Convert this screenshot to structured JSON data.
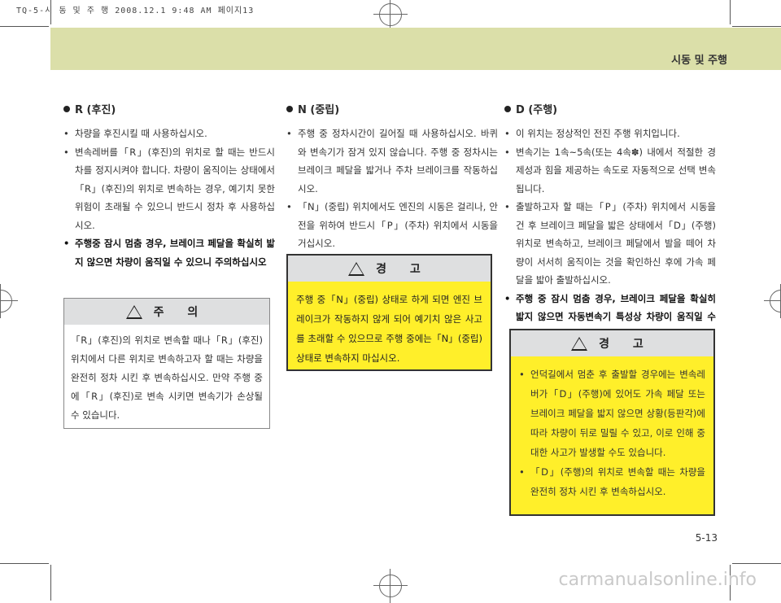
{
  "print_info": "TQ-5-시 동 및 주 행  2008.12.1 9:48 AM 페이지13",
  "header": {
    "title": "시동 및 주행"
  },
  "sections": {
    "r": {
      "title": "R (후진)",
      "items": [
        "차량을 후진시킬 때 사용하십시오.",
        "변속레버를「R」(후진)의 위치로 할 때는 반드시 차를 정지시켜야 합니다. 차량이 움직이는 상태에서「R」(후진)의 위치로 변속하는 경우, 예기치 못한 위험이 초래될 수 있으니 반드시 정차 후 사용하십시오.",
        "주행중 잠시 멈춤 경우, 브레이크 페달을 확실히 밟지 않으면 차량이 움직일 수 있으니 주의하십시오"
      ]
    },
    "n": {
      "title": "N (중립)",
      "items": [
        "주행 중 정차시간이 길어질 때 사용하십시오. 바퀴와 변속기가 잠겨 있지 않습니다. 주행 중 정차시는 브레이크 페달을 밟거나 주차 브레이크를 작동하십시오.",
        "「N」(중립) 위치에서도 엔진의 시동은 걸리나, 안전을 위하여 반드시「P」(주차) 위치에서 시동을 거십시오."
      ]
    },
    "d": {
      "title": "D (주행)",
      "items": [
        "이 위치는 정상적인 전진 주행 위치입니다.",
        "변속기는 1속~5속(또는 4속✽) 내에서 적절한 경제성과 힘을 제공하는 속도로 자동적으로 선택 변속됩니다.",
        "출발하고자 할 때는「P」(주차) 위치에서 시동을 건 후 브레이크 페달을 밟은 상태에서「D」(주행) 위치로 변속하고, 브레이크 페달에서 발을 떼어 차량이 서서히 움직이는 것을 확인하신 후에 가속 페달을 밟아 출발하십시오.",
        "주행 중 잠시 멈춤 경우, 브레이크 페달을 확실히 밟지 않으면 자동변속기 특성상 차량이 움직일 수 있으니 주의 하십시오."
      ]
    }
  },
  "caution": {
    "title": "주 의",
    "mark": "!",
    "text": "「R」(후진)의 위치로 변속할 때나「R」(후진) 위치에서 다른 위치로 변속하고자 할 때는 차량을 완전히 정차 시킨 후 변속하십시오. 만약 주행 중에「R」(후진)로 변속 시키면 변속기가 손상될 수 있습니다."
  },
  "warning_mid": {
    "title": "경 고",
    "mark": "!",
    "text": "주행 중「N」(중립) 상태로 하게 되면 엔진 브레이크가 작동하지 않게 되어 예기치 않은 사고를 초래할 수 있으므로 주행 중에는「N」(중립) 상태로 변속하지 마십시오."
  },
  "warning_right": {
    "title": "경 고",
    "mark": "!",
    "items": [
      "언덕길에서 멈춘 후 출발할 경우에는 변속레버가「D」(주행)에 있어도 가속 페달 또는 브레이크 페달을 밟지 않으면 상황(등판각)에 따라 차량이 뒤로 밀릴 수 있고, 이로 인해 중대한 사고가 발생할 수도 있습니다.",
      "「D」(주행)의 위치로 변속할 때는 차량을 완전히 정차 시킨 후 변속하십시오."
    ]
  },
  "page_number": "5-13",
  "watermark": "carmanualsonline.info"
}
